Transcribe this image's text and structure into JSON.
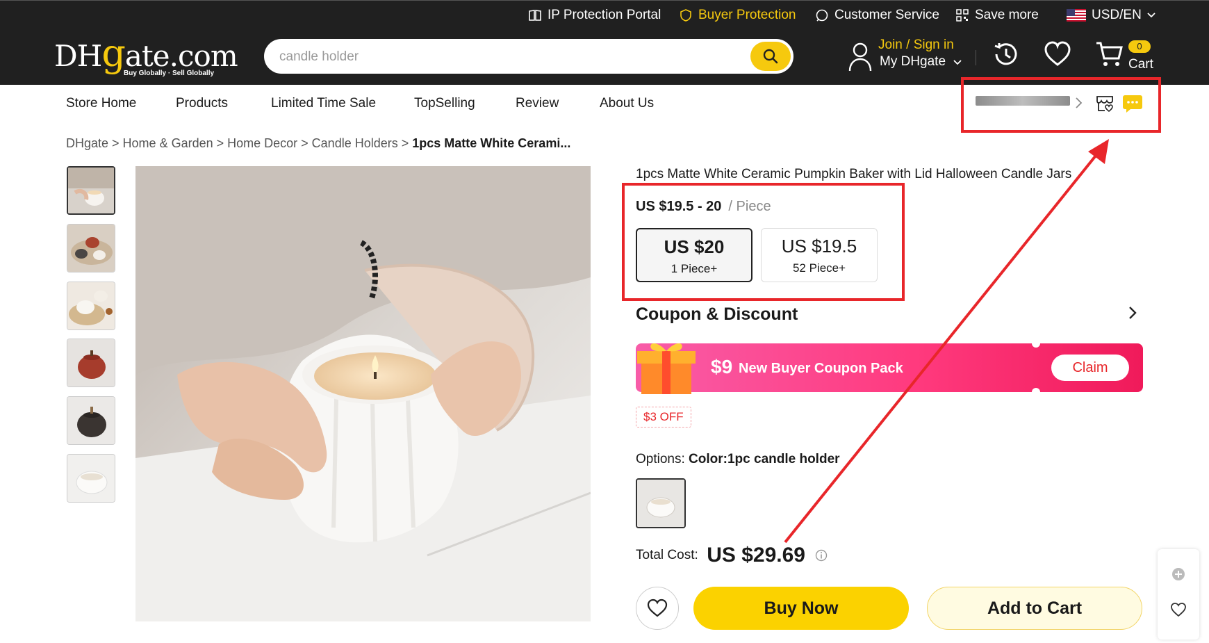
{
  "topbar": {
    "ip_portal": "IP Protection Portal",
    "buyer_protection": "Buyer Protection",
    "customer_service": "Customer Service",
    "save_more": "Save more",
    "currency": "USD/EN"
  },
  "header": {
    "logo_text": "DHgate.com",
    "slogan": "Buy Globally · Sell Globally",
    "search_value": "candle holder",
    "join": "Join / Sign in",
    "my_account": "My DHgate",
    "cart_count": "0",
    "cart_label": "Cart"
  },
  "store_nav": [
    "Store Home",
    "Products",
    "Limited Time Sale",
    "TopSelling",
    "Review",
    "About Us"
  ],
  "breadcrumb": {
    "items": [
      "DHgate",
      "Home & Garden",
      "Home Decor",
      "Candle Holders"
    ],
    "current": "1pcs Matte White Cerami..."
  },
  "product": {
    "title": "1pcs Matte White Ceramic Pumpkin Baker with Lid Halloween Candle Jars",
    "price_range": "US $19.5 - 20",
    "price_unit": "/ Piece",
    "tiers": [
      {
        "price": "US $20",
        "qty": "1 Piece+"
      },
      {
        "price": "US $19.5",
        "qty": "52 Piece+"
      }
    ],
    "coupon_heading": "Coupon & Discount",
    "coupon_amount": "$9",
    "coupon_text": "New Buyer Coupon Pack",
    "claim": "Claim",
    "off_tag": "$3 OFF",
    "options_label": "Options:",
    "options_value": "Color:1pc candle holder",
    "total_label": "Total Cost:",
    "total_value": "US $29.69",
    "buy_now": "Buy Now",
    "add_to_cart": "Add to Cart"
  },
  "colors": {
    "accent": "#f6c90e",
    "dark": "#202020",
    "annotation_red": "#e8262a",
    "coupon_pink": "#ff3a7e"
  }
}
